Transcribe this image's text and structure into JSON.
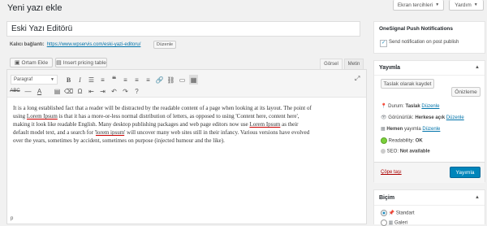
{
  "page_title": "Yeni yazı ekle",
  "top_buttons": {
    "screen_options": "Ekran tercihleri",
    "help": "Yardım"
  },
  "post": {
    "title_value": "Eski Yazı Editörü",
    "permalink_label": "Kalıcı bağlantı:",
    "permalink_url": "https://www.wpservis.com/eski-yazi-editoru/",
    "edit_button": "Düzenle"
  },
  "editor": {
    "add_media": "Ortam Ekle",
    "insert_pricing": "Insert pricing table",
    "tab_visual": "Görsel",
    "tab_text": "Metin",
    "format_select": "Paragraf",
    "body": [
      {
        "t": "It is a long established fact that a reader will be distracted by the readable content of a page when looking at its layout. The point of"
      },
      {
        "t": "using "
      },
      {
        "t": "Lorem Ipsum",
        "u": true
      },
      {
        "t": " is that it has a more-or-less normal distribution of letters, as opposed to using 'Content here, content here',"
      },
      {
        "t": "making it look like readable English. Many desktop publishing packages and web page editors now use "
      },
      {
        "t": "Lorem Ipsum",
        "u": true
      },
      {
        "t": " as their"
      },
      {
        "t": "default model text, and a search for '"
      },
      {
        "t": "lorem ipsum",
        "u": true
      },
      {
        "t": "' will uncover many web sites still in their infancy. Various versions have evolved"
      },
      {
        "t": "over the years, sometimes by accident, sometimes on purpose (injected humour and the like)."
      }
    ],
    "status_path": "p"
  },
  "onesignal": {
    "title": "OneSignal Push Notifications",
    "checkbox_label": "Send notification on post publish",
    "checked": true
  },
  "publish": {
    "title": "Yayımla",
    "save_draft": "Taslak olarak kaydet",
    "preview": "Önizleme",
    "status_label": "Durum:",
    "status_value": "Taslak",
    "visibility_label": "Görünürlük:",
    "visibility_value": "Herkese açık",
    "schedule_label": "Hemen",
    "schedule_suffix": "yayımla",
    "readability_label": "Readability:",
    "readability_value": "OK",
    "seo_label": "SEO:",
    "seo_value": "Not available",
    "edit_link": "Düzenle",
    "trash": "Çöpe taşı",
    "publish_button": "Yayımla"
  },
  "format_box": {
    "title": "Biçim",
    "options": [
      "Standart",
      "Galeri"
    ]
  },
  "colors": {
    "accent": "#0073aa",
    "publish_btn": "#0085ba",
    "trash": "#a00",
    "ok_green": "#7ad03a"
  }
}
